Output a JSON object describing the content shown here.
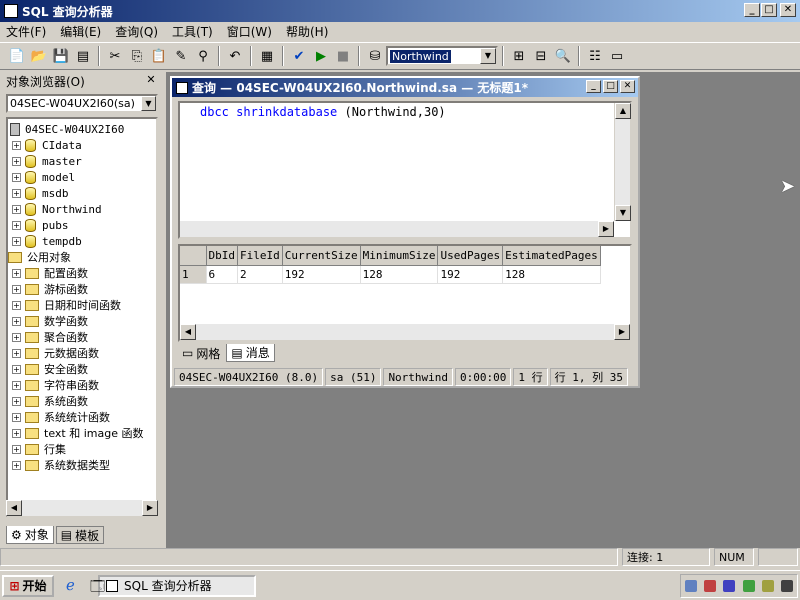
{
  "app": {
    "title": "SQL 查询分析器",
    "window_buttons": {
      "min": "_",
      "max": "□",
      "close": "✕"
    }
  },
  "menu": [
    "文件(F)",
    "编辑(E)",
    "查询(Q)",
    "工具(T)",
    "窗口(W)",
    "帮助(H)"
  ],
  "toolbar": {
    "database": "Northwind"
  },
  "object_browser": {
    "title": "对象浏览器(O)",
    "server_combo": "04SEC-W04UX2I60(sa)",
    "root": "04SEC-W04UX2I60",
    "databases": [
      "CIdata",
      "master",
      "model",
      "msdb",
      "Northwind",
      "pubs",
      "tempdb"
    ],
    "common_objects": "公用对象",
    "categories": [
      "配置函数",
      "游标函数",
      "日期和时间函数",
      "数学函数",
      "聚合函数",
      "元数据函数",
      "安全函数",
      "字符串函数",
      "系统函数",
      "系统统计函数",
      "text 和 image 函数",
      "行集",
      "系统数据类型"
    ],
    "tab_objects": "对象",
    "tab_templates": "模板"
  },
  "query_window": {
    "title": "查询 — 04SEC-W04UX2I60.Northwind.sa — 无标题1*",
    "code_keyword": "dbcc shrinkdatabase",
    "code_args": "(Northwind,30)",
    "grid": {
      "columns": [
        "DbId",
        "FileId",
        "CurrentSize",
        "MinimumSize",
        "UsedPages",
        "EstimatedPages"
      ],
      "rows": [
        {
          "num": "1",
          "cells": [
            "6",
            "2",
            "192",
            "128",
            "192",
            "128"
          ]
        }
      ]
    },
    "tab_grid": "网格",
    "tab_messages": "消息",
    "status": {
      "server": "04SEC-W04UX2I60 (8.0)",
      "user": "sa (51)",
      "db": "Northwind",
      "time": "0:00:00",
      "rows": "1 行",
      "pos": "行 1, 列 35"
    }
  },
  "statusbar": {
    "connections": "连接: 1",
    "num": "NUM"
  },
  "taskbar": {
    "start": "开始",
    "task": "SQL 查询分析器"
  }
}
